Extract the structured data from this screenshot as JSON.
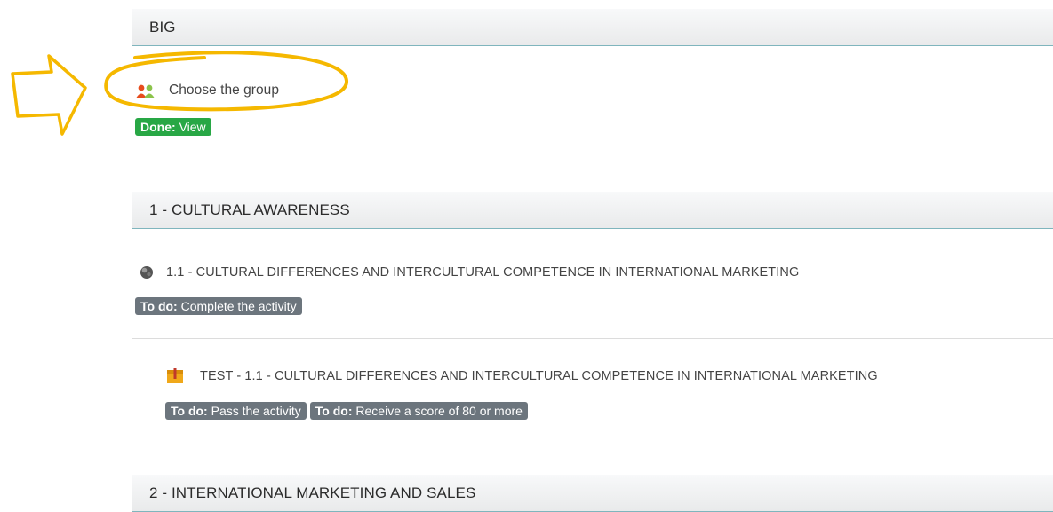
{
  "sections": [
    {
      "title": "BIG"
    },
    {
      "title": "1 - CULTURAL AWARENESS"
    },
    {
      "title": "2 - INTERNATIONAL MARKETING AND SALES"
    }
  ],
  "group_activity": {
    "name": "Choose the group",
    "icon": "group-icon",
    "badge": {
      "label": "Done:",
      "text": "View",
      "color": "#28a745"
    }
  },
  "activities": [
    {
      "name": "1.1 - CULTURAL DIFFERENCES AND INTERCULTURAL COMPETENCE IN INTERNATIONAL MARKETING",
      "icon": "scorm-package-icon",
      "badges": [
        {
          "label": "To do:",
          "text": "Complete the activity"
        }
      ]
    },
    {
      "name": "TEST - 1.1 - CULTURAL DIFFERENCES AND INTERCULTURAL COMPETENCE IN INTERNATIONAL MARKETING",
      "icon": "quiz-icon",
      "badges": [
        {
          "label": "To do:",
          "text": "Pass the activity"
        },
        {
          "label": "To do:",
          "text": "Receive a score of 80 or more"
        }
      ]
    }
  ],
  "annotation": {
    "color": "#f5b800",
    "shapes": [
      "arrow",
      "ellipse"
    ]
  }
}
